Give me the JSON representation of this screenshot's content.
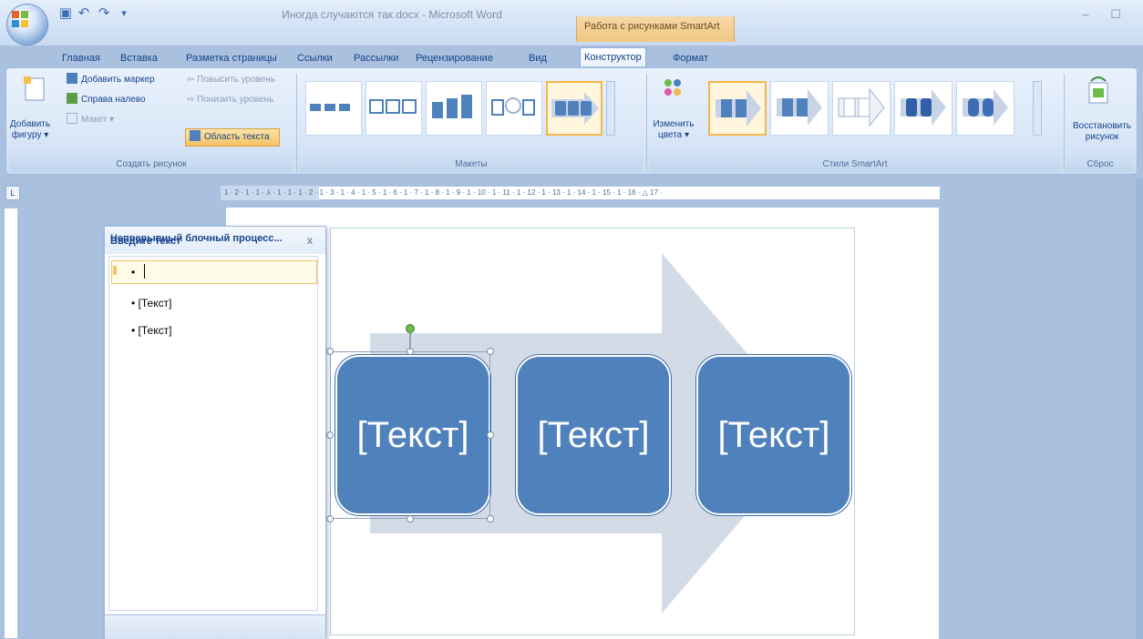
{
  "window": {
    "title": "Иногда случаются так.docx - Microsoft Word",
    "contextual_tab": "Работа с рисунками SmartArt",
    "controls": "–  ☐"
  },
  "quick_access": [
    "save-icon",
    "undo-icon",
    "redo-icon",
    "customize-icon"
  ],
  "tabs": [
    {
      "label": "Главная"
    },
    {
      "label": "Вставка"
    },
    {
      "label": "Разметка страницы"
    },
    {
      "label": "Ссылки"
    },
    {
      "label": "Рассылки"
    },
    {
      "label": "Рецензирование"
    },
    {
      "label": "Вид"
    },
    {
      "label": "Конструктор",
      "active": true
    },
    {
      "label": "Формат"
    }
  ],
  "ribbon": {
    "create_group": {
      "label": "Создать рисунок",
      "add_shape": "Добавить фигуру ▾",
      "add_bullet": "Добавить маркер",
      "right_to_left": "Справа налево",
      "layout": "Макет ▾",
      "promote": "Повысить уровень",
      "demote": "Понизить уровень",
      "text_pane": "Область текста"
    },
    "layouts_group": {
      "label": "Макеты"
    },
    "styles_group": {
      "label": "Стили SmartArt",
      "change_colors": "Изменить цвета ▾"
    },
    "reset_group": {
      "label": "Сброс",
      "reset_graphic": "Восстановить рисунок"
    }
  },
  "ruler": {
    "horizontal": "1 · 2 · 1 · 1 · ⅄ · 1 · 1 · 1 · 2 · 1 · 3 · 1 · 4 · 1 · 5 · 1 · 6 · 1 · 7 · 1 · 8 · 1 · 9 · 1 · 10 · 1 · 11 · 1 · 12 · 1 · 13 · 1 · 14 · 1 · 15 · 1 · 16 · △ 17 ·",
    "corner": "L"
  },
  "text_pane": {
    "title": "Введите текст",
    "close": "x",
    "items": [
      "•",
      "• [Текст]",
      "• [Текст]"
    ],
    "footer": "Непрерывный блочный процесс..."
  },
  "smartart": {
    "boxes": [
      "[Текст]",
      "[Текст]",
      "[Текст]"
    ],
    "box_color": "#4f81bd",
    "arrow_color": "#d3dbe7"
  },
  "colors": {
    "ribbon_bg": "#dde9f8",
    "accent_blue": "#4f81bd",
    "selection_orange": "#f3b64b"
  }
}
